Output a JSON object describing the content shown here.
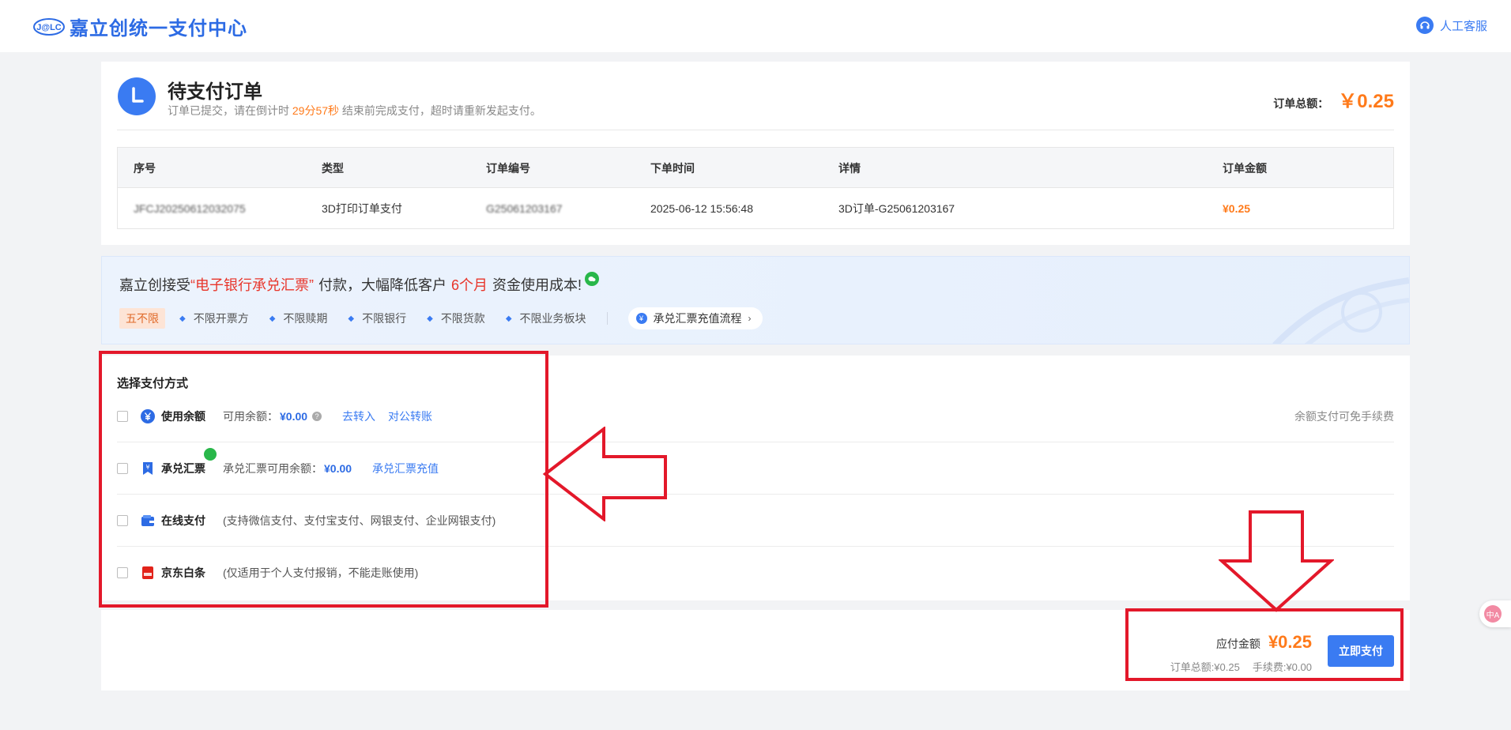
{
  "header": {
    "logo_mark": "J@LC",
    "logo_text": "嘉立创统一支付中心",
    "service_label": "人工客服"
  },
  "order": {
    "title": "待支付订单",
    "sub_prefix": "订单已提交，请在倒计时 ",
    "countdown": "29分57秒",
    "sub_suffix": " 结束前完成支付，超时请重新发起支付。",
    "total_label": "订单总额：",
    "total_amount": "￥0.25",
    "table": {
      "headers": [
        "序号",
        "类型",
        "订单编号",
        "下单时间",
        "详情",
        "订单金额"
      ],
      "rows": [
        [
          "JFCJ20250612032075",
          "3D打印订单支付",
          "G25061203167",
          "2025-06-12 15:56:48",
          "3D订单-G25061203167",
          "¥0.25"
        ]
      ]
    }
  },
  "banner": {
    "t1": "嘉立创接受",
    "t2": "“电子银行承兑汇票”",
    "t3": "付款，大幅降低客户",
    "t4": "6个月",
    "t5": "资金使用成本!",
    "badge": "五不限",
    "tags": [
      "不限开票方",
      "不限赎期",
      "不限银行",
      "不限货款",
      "不限业务板块"
    ],
    "flow_button": "承兑汇票充值流程",
    "flow_icon": "¥"
  },
  "payment": {
    "title": "选择支付方式",
    "methods": [
      {
        "name": "使用余额",
        "desc": "可用余额：",
        "value": "¥0.00",
        "help": "?",
        "link1": "去转入",
        "link2": "对公转账",
        "note": "余额支付可免手续费",
        "icon": "yen-circle-icon"
      },
      {
        "name": "承兑汇票",
        "desc": "承兑汇票可用余额：",
        "value": "¥0.00",
        "link1": "承兑汇票充值",
        "icon": "bill-icon"
      },
      {
        "name": "在线支付",
        "desc": "(支持微信支付、支付宝支付、网银支付、企业网银支付)",
        "icon": "wallet-icon"
      },
      {
        "name": "京东白条",
        "desc": "(仅适用于个人支付报销，不能走账使用)",
        "icon": "jd-icon"
      }
    ]
  },
  "footer": {
    "payable_label": "应付金额",
    "payable_amount": "¥0.25",
    "order_total": "订单总额:¥0.25",
    "fee": "手续费:¥0.00",
    "pay_button": "立即支付"
  },
  "translate_icon": "中A",
  "colors": {
    "primary": "#3a7bf2",
    "orange": "#ff7a1a",
    "annotation_red": "#e3182a",
    "banner_red": "#e8352a"
  }
}
